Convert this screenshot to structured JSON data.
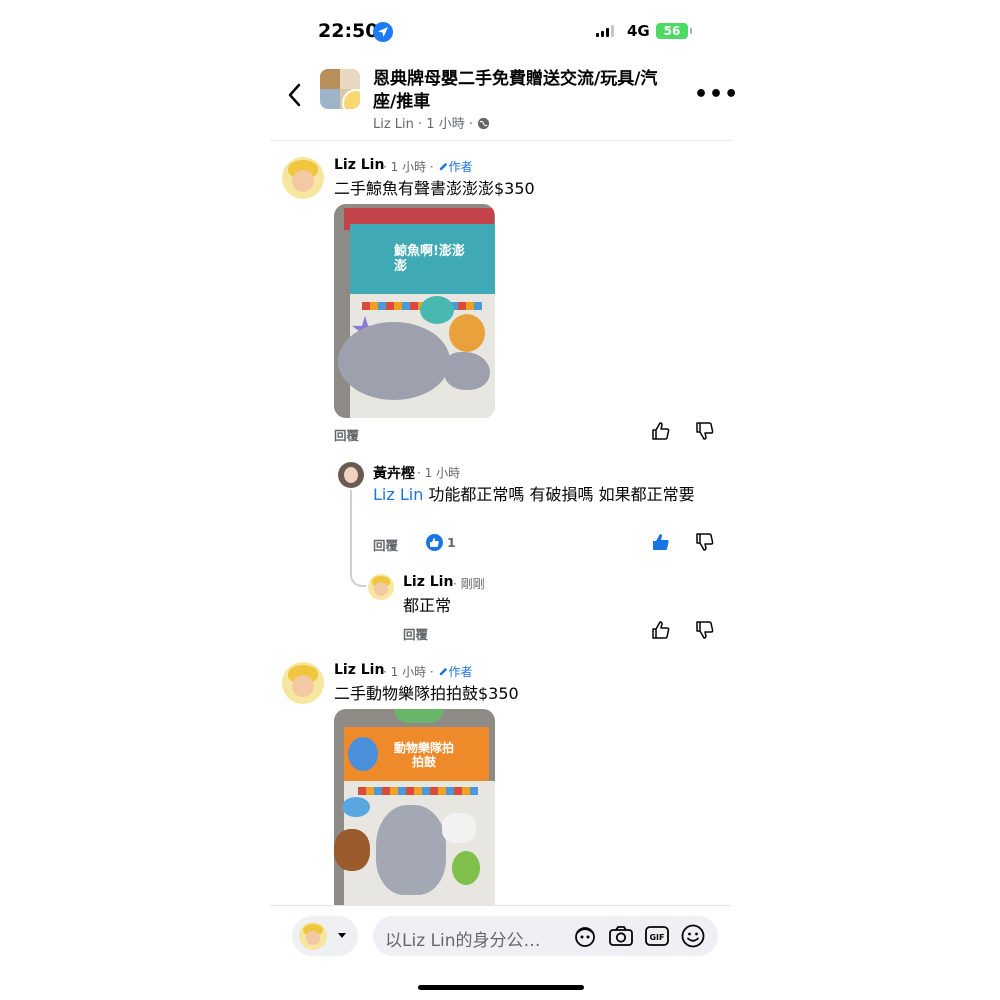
{
  "status": {
    "time": "22:50",
    "network": "4G",
    "battery": "56"
  },
  "header": {
    "title": "恩典牌母嬰二手免費贈送交流/玩具/汽座/推車",
    "subtitle": "Liz Lin · 1 小時 · "
  },
  "comments": [
    {
      "name": "Liz Lin",
      "meta": " · 1 小時 · ",
      "author_label": "作者",
      "text": "二手鯨魚有聲書澎澎澎$350",
      "reply_label": "回覆",
      "photo_title": "鯨魚啊!澎澎澎"
    },
    {
      "name": "黃卉樫",
      "meta": " · 1 小時",
      "mention": "Liz Lin",
      "text": " 功能都正常嗎 有破損嗎 如果都正常要",
      "reply_label": "回覆",
      "like_count": "1"
    },
    {
      "name": "Liz Lin",
      "meta": " · 剛剛",
      "text": "都正常",
      "reply_label": "回覆"
    },
    {
      "name": "Liz Lin",
      "meta": " · 1 小時 · ",
      "author_label": "作者",
      "text": "二手動物樂隊拍拍鼓$350",
      "photo_title": "動物樂隊拍拍鼓"
    }
  ],
  "composer": {
    "placeholder": "以Liz Lin的身分公…"
  },
  "icons": [
    "location-arrow-icon",
    "signal-icon",
    "battery-icon",
    "back-chevron-icon",
    "more-icon",
    "globe-icon",
    "pencil-icon",
    "thumbs-up-icon",
    "thumbs-down-icon",
    "like-reaction-icon",
    "caret-down-icon",
    "avatar-sticker-icon",
    "camera-icon",
    "gif-icon",
    "emoji-icon"
  ],
  "colors": {
    "accent": "#1b74e4",
    "secondary_text": "#65676b",
    "battery": "#4cd964"
  }
}
